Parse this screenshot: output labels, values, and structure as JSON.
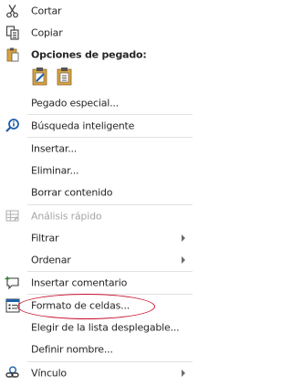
{
  "menu": {
    "cut": "Cortar",
    "copy": "Copiar",
    "paste_options_heading": "Opciones de pegado:",
    "paste_special": "Pegado especial...",
    "smart_lookup": "Búsqueda inteligente",
    "insert": "Insertar...",
    "delete": "Eliminar...",
    "clear_contents": "Borrar contenido",
    "quick_analysis": "Análisis rápido",
    "filter": "Filtrar",
    "sort": "Ordenar",
    "insert_comment": "Insertar comentario",
    "format_cells": "Formato de celdas...",
    "pick_from_list": "Elegir de la lista desplegable...",
    "define_name": "Definir nombre...",
    "link": "Vínculo"
  },
  "colors": {
    "annotation_circle": "#c8102e",
    "disabled_text": "#a6a6a6"
  }
}
